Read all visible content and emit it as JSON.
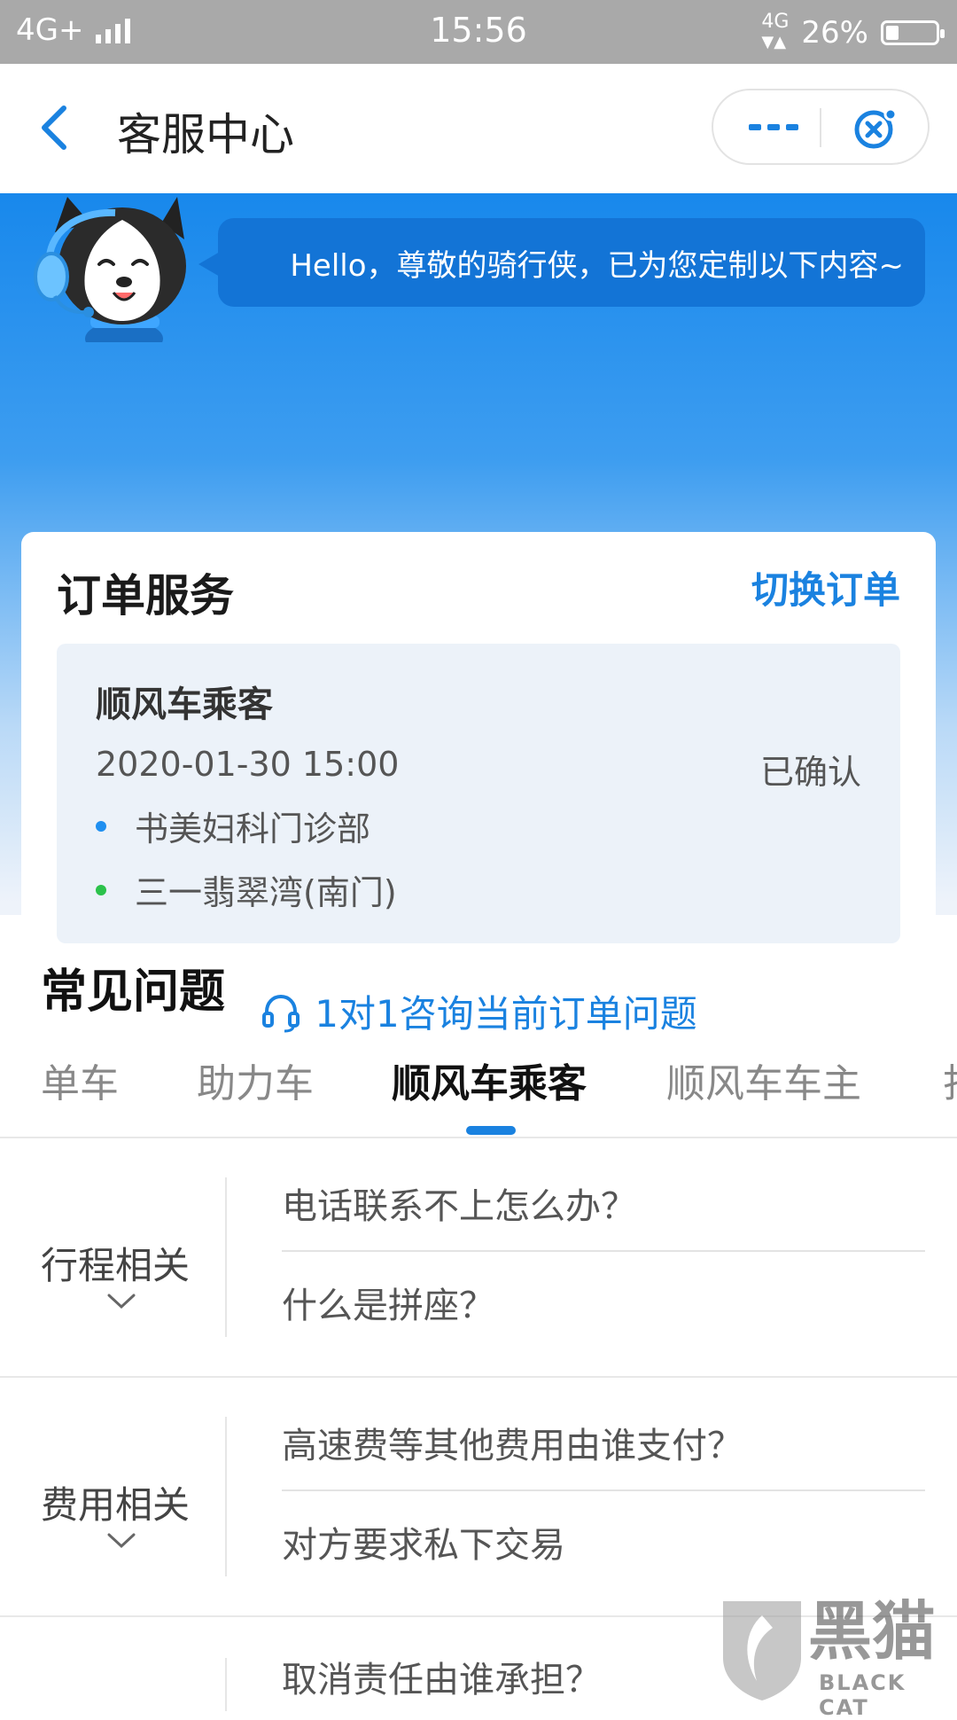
{
  "status_bar": {
    "network": "4G+",
    "time": "15:56",
    "net_right": "4G",
    "battery": "26%",
    "battery_level": 0.26
  },
  "nav": {
    "title": "客服中心"
  },
  "hero": {
    "greeting": "Hello，尊敬的骑行侠，已为您定制以下内容~"
  },
  "order_service": {
    "title": "订单服务",
    "switch_label": "切换订单",
    "order": {
      "type": "顺风车乘客",
      "datetime": "2020-01-30 15:00",
      "status": "已确认",
      "origin": "书美妇科门诊部",
      "destination": "三一翡翠湾(南门)"
    },
    "consult_label": "1对1咨询当前订单问题",
    "colors": {
      "accent": "#1a82e0",
      "origin_dot": "#1f8ff0",
      "destination_dot": "#2bc24b"
    }
  },
  "faq": {
    "title": "常见问题",
    "tabs": [
      {
        "label": "单车"
      },
      {
        "label": "助力车"
      },
      {
        "label": "顺风车乘客"
      },
      {
        "label": "顺风车车主"
      },
      {
        "label": "打"
      }
    ],
    "active_tab": "顺风车乘客",
    "categories": [
      {
        "label": "行程相关",
        "questions": [
          "电话联系不上怎么办？",
          "什么是拼座？"
        ]
      },
      {
        "label": "费用相关",
        "questions": [
          "高速费等其他费用由谁支付？",
          "对方要求私下交易"
        ]
      },
      {
        "label": "",
        "questions": [
          "取消责任由谁承担？"
        ]
      }
    ]
  },
  "watermark": {
    "text_cn": "黑猫",
    "text_en": "BLACK CAT"
  }
}
